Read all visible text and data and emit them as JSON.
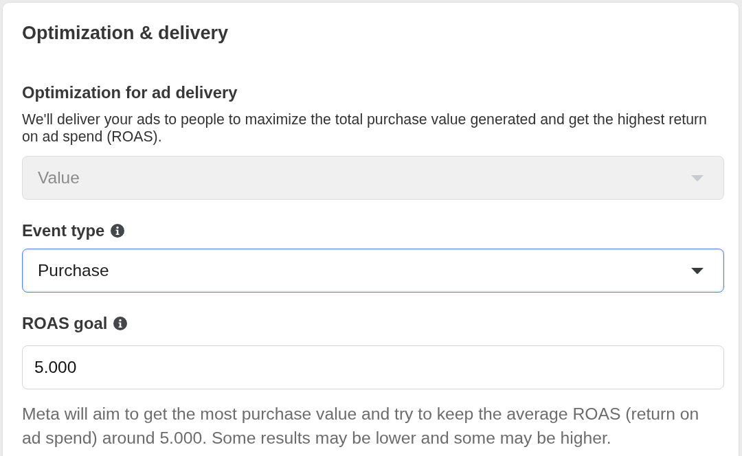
{
  "panel": {
    "title": "Optimization & delivery"
  },
  "sections": [
    {
      "label": "Optimization for ad delivery",
      "has_info": false,
      "description": "We'll deliver your ads to people to maximize the total purchase value generated and get the highest return on ad spend (ROAS).",
      "field": {
        "kind": "select",
        "value": "Value",
        "disabled": true,
        "focused": false
      }
    },
    {
      "label": "Event type",
      "has_info": true,
      "field": {
        "kind": "select",
        "value": "Purchase",
        "disabled": false,
        "focused": true
      }
    },
    {
      "label": "ROAS goal",
      "has_info": true,
      "field": {
        "kind": "input",
        "value": "5.000",
        "disabled": false,
        "focused": false
      },
      "help_text": "Meta will aim to get the most purchase value and try to keep the average ROAS (return on ad spend) around 5.000. Some results may be lower and some may be higher."
    }
  ]
}
